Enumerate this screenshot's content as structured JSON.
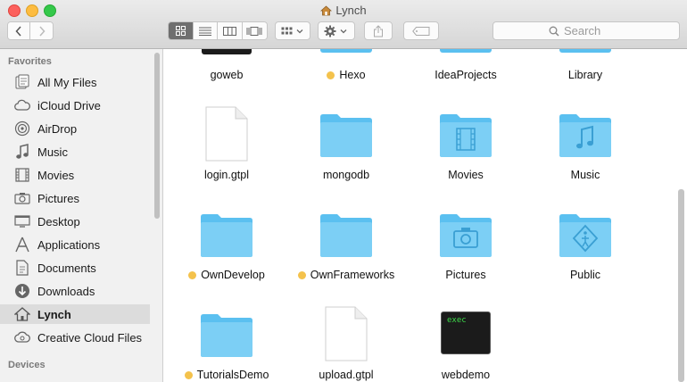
{
  "window": {
    "title": "Lynch"
  },
  "toolbar": {
    "back_label": "‹",
    "forward_label": "›",
    "search_placeholder": "Search"
  },
  "sidebar": {
    "favorites_label": "Favorites",
    "devices_label": "Devices",
    "items": [
      {
        "label": "All My Files",
        "icon": "all-files-icon"
      },
      {
        "label": "iCloud Drive",
        "icon": "cloud-icon"
      },
      {
        "label": "AirDrop",
        "icon": "airdrop-icon"
      },
      {
        "label": "Music",
        "icon": "music-note-icon"
      },
      {
        "label": "Movies",
        "icon": "film-icon"
      },
      {
        "label": "Pictures",
        "icon": "camera-icon"
      },
      {
        "label": "Desktop",
        "icon": "desktop-icon"
      },
      {
        "label": "Applications",
        "icon": "applications-icon"
      },
      {
        "label": "Documents",
        "icon": "document-icon"
      },
      {
        "label": "Downloads",
        "icon": "download-icon"
      },
      {
        "label": "Lynch",
        "icon": "home-icon",
        "selected": true
      },
      {
        "label": "Creative Cloud Files",
        "icon": "creative-cloud-icon"
      }
    ]
  },
  "files": [
    {
      "name": "goweb",
      "kind": "exec"
    },
    {
      "name": "Hexo",
      "kind": "folder",
      "tag": "yellow"
    },
    {
      "name": "IdeaProjects",
      "kind": "folder"
    },
    {
      "name": "Library",
      "kind": "folder"
    },
    {
      "name": "login.gtpl",
      "kind": "document"
    },
    {
      "name": "mongodb",
      "kind": "folder"
    },
    {
      "name": "Movies",
      "kind": "folder",
      "badge": "film"
    },
    {
      "name": "Music",
      "kind": "folder",
      "badge": "music"
    },
    {
      "name": "OwnDevelop",
      "kind": "folder",
      "tag": "yellow"
    },
    {
      "name": "OwnFrameworks",
      "kind": "folder",
      "tag": "yellow"
    },
    {
      "name": "Pictures",
      "kind": "folder",
      "badge": "camera"
    },
    {
      "name": "Public",
      "kind": "folder",
      "badge": "public"
    },
    {
      "name": "TutorialsDemo",
      "kind": "folder",
      "tag": "yellow"
    },
    {
      "name": "upload.gtpl",
      "kind": "document"
    },
    {
      "name": "webdemo",
      "kind": "exec",
      "exec_text": "exec"
    }
  ],
  "colors": {
    "folder": "#5bc0f0",
    "tag_yellow": "#f4c24c",
    "selected_sidebar": "#dcdcdc"
  }
}
